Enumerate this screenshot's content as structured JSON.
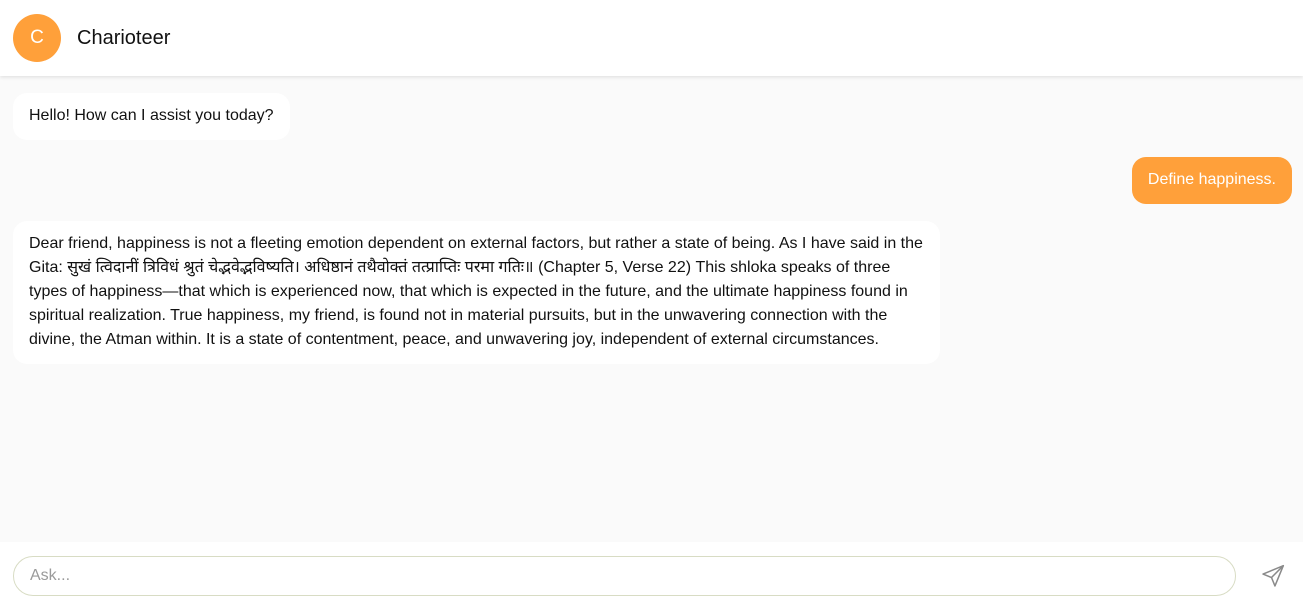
{
  "header": {
    "avatar_letter": "C",
    "title": "Charioteer"
  },
  "messages": [
    {
      "role": "bot",
      "text": "Hello! How can I assist you today?"
    },
    {
      "role": "user",
      "text": "Define happiness."
    },
    {
      "role": "bot",
      "text": "Dear friend, happiness is not a fleeting emotion dependent on external factors, but rather a state of being. As I have said in the Gita: सुखं त्विदानीं त्रिविधं श्रुतं चेद्भवेद्भविष्यति। अधिष्ठानं तथैवोक्तं तत्प्राप्तिः परमा गतिः॥ (Chapter 5, Verse 22) This shloka speaks of three types of happiness—that which is experienced now, that which is expected in the future, and the ultimate happiness found in spiritual realization. True happiness, my friend, is found not in material pursuits, but in the unwavering connection with the divine, the Atman within. It is a state of contentment, peace, and unwavering joy, independent of external circumstances."
    }
  ],
  "composer": {
    "placeholder": "Ask...",
    "value": "",
    "send_icon": "send-icon"
  },
  "colors": {
    "accent": "#ffa03a",
    "chat_background": "#fafafa"
  }
}
